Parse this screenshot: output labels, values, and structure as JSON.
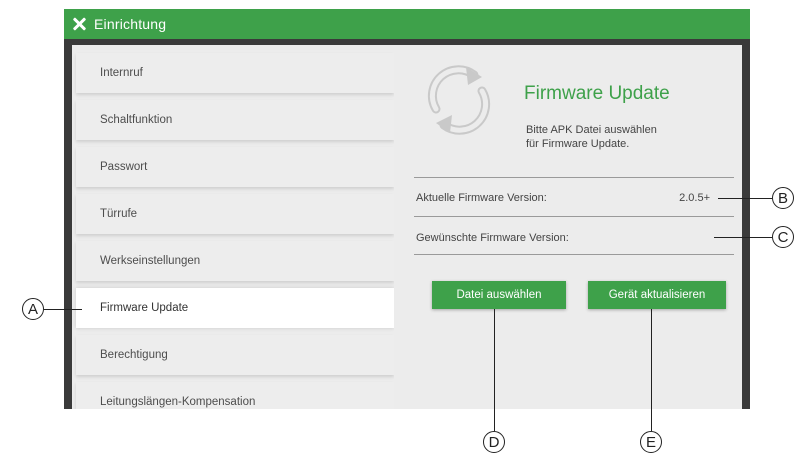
{
  "titlebar": {
    "title": "Einrichtung"
  },
  "sidebar": {
    "items": [
      {
        "label": "Internruf"
      },
      {
        "label": "Schaltfunktion"
      },
      {
        "label": "Passwort"
      },
      {
        "label": "Türrufe"
      },
      {
        "label": "Werkseinstellungen"
      },
      {
        "label": "Firmware Update",
        "active": true
      },
      {
        "label": "Berechtigung"
      },
      {
        "label": "Leitungslängen-Kompensation"
      }
    ]
  },
  "panel": {
    "title": "Firmware Update",
    "description_line1": "Bitte APK Datei auswählen",
    "description_line2": "für Firmware Update.",
    "current_version_label": "Aktuelle Firmware Version:",
    "current_version_value": "2.0.5+",
    "desired_version_label": "Gewünschte Firmware Version:",
    "select_file_button": "Datei auswählen",
    "update_device_button": "Gerät aktualisieren"
  },
  "callouts": {
    "a": "A",
    "b": "B",
    "c": "C",
    "d": "D",
    "e": "E"
  },
  "colors": {
    "accent": "#3ea14a",
    "frame": "#3a3a3a",
    "background": "#ececec"
  },
  "icons": {
    "close": "close-icon",
    "firmware": "firmware-update-icon"
  }
}
